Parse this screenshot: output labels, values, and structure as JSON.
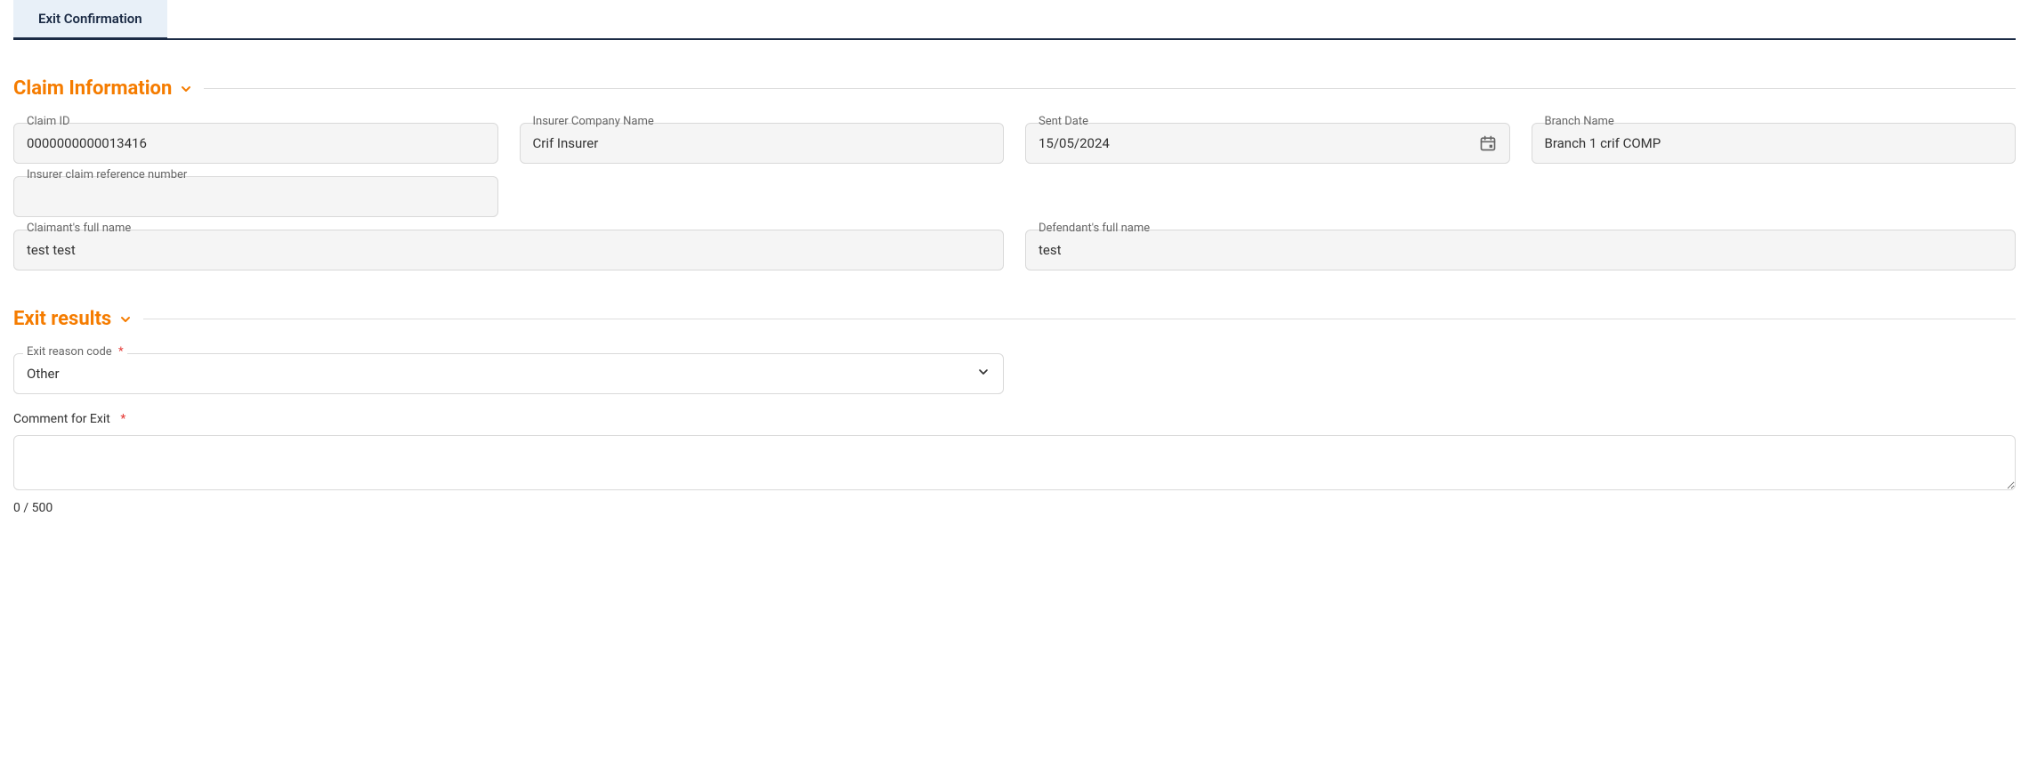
{
  "tabs": {
    "active": "Exit Confirmation"
  },
  "sections": {
    "claim_info": {
      "title": "Claim Information"
    },
    "exit_results": {
      "title": "Exit results"
    }
  },
  "claim": {
    "claim_id": {
      "label": "Claim ID",
      "value": "0000000000013416"
    },
    "insurer_company": {
      "label": "Insurer Company Name",
      "value": "Crif Insurer"
    },
    "sent_date": {
      "label": "Sent Date",
      "value": "15/05/2024"
    },
    "branch_name": {
      "label": "Branch Name",
      "value": "Branch 1 crif COMP"
    },
    "insurer_ref": {
      "label": "Insurer claim reference number",
      "value": ""
    },
    "claimant_full_name": {
      "label": "Claimant's full name",
      "value": "test test"
    },
    "defendant_full_name": {
      "label": "Defendant's full name",
      "value": "test"
    }
  },
  "exit": {
    "reason_code": {
      "label": "Exit reason code",
      "value": "Other",
      "required": "*"
    },
    "comment": {
      "label": "Comment for Exit",
      "required": "*",
      "value": ""
    },
    "counter": "0 / 500"
  }
}
